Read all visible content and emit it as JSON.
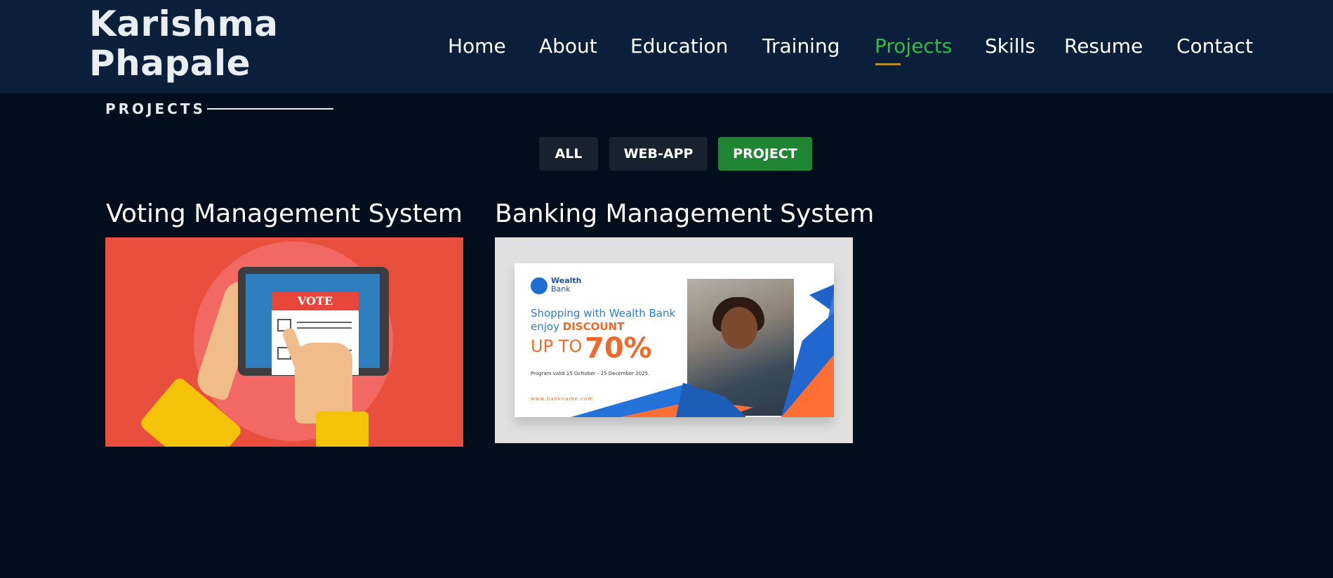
{
  "header": {
    "logo_line1": "Karishma",
    "logo_line2": "Phapale",
    "nav": [
      {
        "label": "Home",
        "active": false
      },
      {
        "label": "About",
        "active": false
      },
      {
        "label": "Education",
        "active": false
      },
      {
        "label": "Training",
        "active": false
      },
      {
        "label": "Projects",
        "active": true
      },
      {
        "label": "Skills",
        "active": false
      },
      {
        "label": "Resume",
        "active": false
      },
      {
        "label": "Contact",
        "active": false
      }
    ]
  },
  "section": {
    "title": "PROJECTS"
  },
  "filters": [
    {
      "label": "ALL",
      "active": false
    },
    {
      "label": "WEB-APP",
      "active": false
    },
    {
      "label": "PROJECT",
      "active": true
    }
  ],
  "projects": [
    {
      "title": "Voting Management System",
      "image_text": "VOTE"
    },
    {
      "title": "Banking Management System",
      "image_text": {
        "brand_line1": "Wealth",
        "brand_line2": "Bank",
        "line1": "Shopping with Wealth Bank",
        "line2_prefix": "enjoy",
        "line2_emphasis": "DISCOUNT",
        "upto": "UP TO",
        "percent": "70%",
        "valid": "Program valid 15 Octtober - 25 December 2025.",
        "url": "www.bankname.com"
      }
    }
  ],
  "colors": {
    "page_bg": "#020e1b",
    "header_bg": "#0b1f3a",
    "nav_active": "#2fbe3f",
    "nav_underline": "#b98a2b",
    "filter_bg": "#17222e",
    "filter_active_bg": "#208533"
  }
}
